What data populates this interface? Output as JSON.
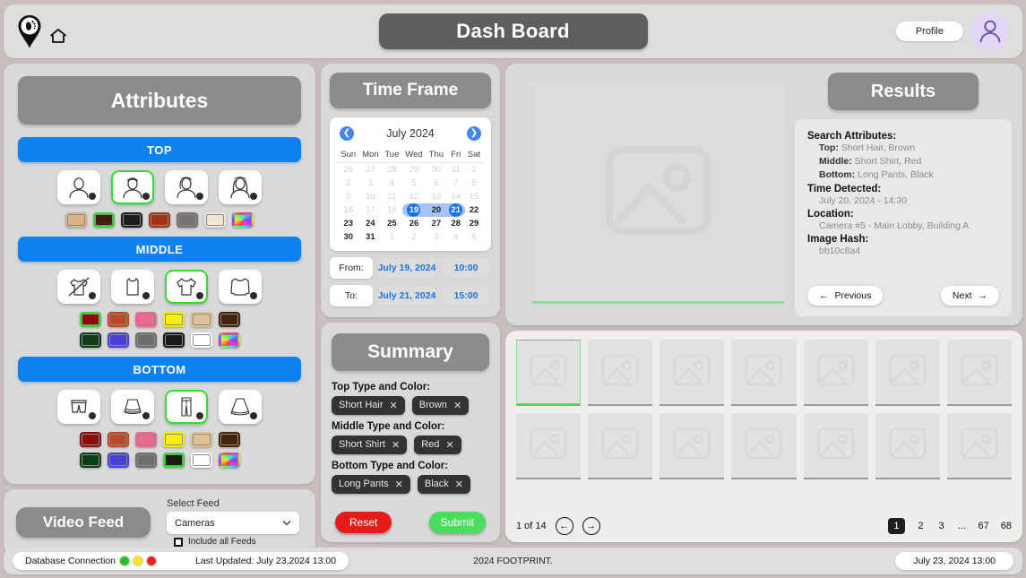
{
  "header": {
    "title": "Dash Board",
    "profile_label": "Profile",
    "logo_icon": "footprint-pin-icon",
    "home_icon": "home-icon",
    "avatar_icon": "user-avatar-icon"
  },
  "attributes": {
    "title": "Attributes",
    "sections": [
      {
        "key": "top",
        "label": "TOP",
        "icons": [
          {
            "name": "hair-long-icon",
            "selected": false
          },
          {
            "name": "hair-short-icon",
            "selected": true
          },
          {
            "name": "hair-medium-icon",
            "selected": false
          },
          {
            "name": "hair-very-long-icon",
            "selected": false
          }
        ],
        "colors": [
          {
            "name": "tan",
            "hex": "#d9b387",
            "selected": false
          },
          {
            "name": "brown",
            "hex": "#3d2008",
            "selected": true
          },
          {
            "name": "black",
            "hex": "#1c1c1c",
            "selected": false
          },
          {
            "name": "rust",
            "hex": "#a33112",
            "selected": false
          },
          {
            "name": "gray",
            "hex": "#77736f",
            "selected": false
          },
          {
            "name": "cream",
            "hex": "#f0e6d8",
            "selected": false
          },
          {
            "name": "multicolor",
            "hex": "rainbow",
            "selected": false
          }
        ]
      },
      {
        "key": "middle",
        "label": "MIDDLE",
        "icons": [
          {
            "name": "no-shirt-icon",
            "selected": false
          },
          {
            "name": "tank-top-icon",
            "selected": false
          },
          {
            "name": "short-shirt-icon",
            "selected": true
          },
          {
            "name": "long-sleeve-icon",
            "selected": false
          }
        ],
        "colors": [
          {
            "name": "red",
            "hex": "#8c0b0b",
            "selected": true
          },
          {
            "name": "orange",
            "hex": "#bd4a26",
            "selected": false
          },
          {
            "name": "pink",
            "hex": "#f2688f",
            "selected": false
          },
          {
            "name": "yellow",
            "hex": "#f5f00a",
            "selected": false
          },
          {
            "name": "tan",
            "hex": "#ddc293",
            "selected": false
          },
          {
            "name": "brown",
            "hex": "#43230a",
            "selected": false
          },
          {
            "name": "green",
            "hex": "#0c3d16",
            "selected": false
          },
          {
            "name": "blue",
            "hex": "#4840d6",
            "selected": false
          },
          {
            "name": "gray",
            "hex": "#6e6e6e",
            "selected": false
          },
          {
            "name": "black",
            "hex": "#1c1915",
            "selected": false
          },
          {
            "name": "white",
            "hex": "#ffffff",
            "selected": false
          },
          {
            "name": "multicolor",
            "hex": "rainbow",
            "selected": false
          }
        ]
      },
      {
        "key": "bottom",
        "label": "BOTTOM",
        "icons": [
          {
            "name": "shorts-icon",
            "selected": false
          },
          {
            "name": "short-skirt-icon",
            "selected": false
          },
          {
            "name": "long-pants-icon",
            "selected": true
          },
          {
            "name": "long-skirt-icon",
            "selected": false
          }
        ],
        "colors": [
          {
            "name": "red",
            "hex": "#8c0b0b",
            "selected": false
          },
          {
            "name": "orange",
            "hex": "#bd4a26",
            "selected": false
          },
          {
            "name": "pink",
            "hex": "#f2688f",
            "selected": false
          },
          {
            "name": "yellow",
            "hex": "#f5f00a",
            "selected": false
          },
          {
            "name": "tan",
            "hex": "#ddc293",
            "selected": false
          },
          {
            "name": "brown",
            "hex": "#43230a",
            "selected": false
          },
          {
            "name": "green",
            "hex": "#0c3d16",
            "selected": false
          },
          {
            "name": "blue",
            "hex": "#4840d6",
            "selected": false
          },
          {
            "name": "gray",
            "hex": "#6e6e6e",
            "selected": false
          },
          {
            "name": "black",
            "hex": "#1c1915",
            "selected": true
          },
          {
            "name": "white",
            "hex": "#ffffff",
            "selected": false
          },
          {
            "name": "multicolor",
            "hex": "rainbow",
            "selected": false
          }
        ]
      }
    ]
  },
  "video_feed": {
    "title": "Video Feed",
    "select_label": "Select Feed",
    "select_value": "Cameras",
    "checkbox_label": "Include all Feeds",
    "checkbox_checked": false,
    "chevron_icon": "chevron-down-icon"
  },
  "time_frame": {
    "title": "Time Frame",
    "ghost_text": "Frame",
    "calendar": {
      "month_label": "July 2024",
      "prev_icon": "chevron-left-icon",
      "next_icon": "chevron-right-icon",
      "weekdays": [
        "Sun",
        "Mon",
        "Tue",
        "Wed",
        "Thu",
        "Fri",
        "Sat"
      ],
      "weeks": [
        [
          {
            "d": "26",
            "muted": true
          },
          {
            "d": "27",
            "muted": true
          },
          {
            "d": "28",
            "muted": true
          },
          {
            "d": "29",
            "muted": true
          },
          {
            "d": "30",
            "muted": true
          },
          {
            "d": "31",
            "muted": true
          },
          {
            "d": "1",
            "muted": true
          }
        ],
        [
          {
            "d": "2",
            "muted": true
          },
          {
            "d": "3",
            "muted": true
          },
          {
            "d": "4",
            "muted": true
          },
          {
            "d": "5",
            "muted": true
          },
          {
            "d": "6",
            "muted": true
          },
          {
            "d": "7",
            "muted": true
          },
          {
            "d": "8",
            "muted": true
          }
        ],
        [
          {
            "d": "9",
            "muted": true
          },
          {
            "d": "10",
            "muted": true
          },
          {
            "d": "11",
            "muted": true
          },
          {
            "d": "12",
            "muted": true
          },
          {
            "d": "13",
            "muted": true
          },
          {
            "d": "14",
            "muted": true
          },
          {
            "d": "15",
            "muted": true
          }
        ],
        [
          {
            "d": "16",
            "muted": true
          },
          {
            "d": "17",
            "muted": true
          },
          {
            "d": "18",
            "muted": true
          },
          {
            "d": "19",
            "muted": false,
            "range": "start"
          },
          {
            "d": "20",
            "muted": false,
            "range": "mid"
          },
          {
            "d": "21",
            "muted": false,
            "range": "end"
          },
          {
            "d": "22",
            "muted": false
          }
        ],
        [
          {
            "d": "23",
            "muted": false
          },
          {
            "d": "24",
            "muted": false
          },
          {
            "d": "25",
            "muted": false
          },
          {
            "d": "26",
            "muted": false
          },
          {
            "d": "27",
            "muted": false
          },
          {
            "d": "28",
            "muted": false
          },
          {
            "d": "29",
            "muted": false
          }
        ],
        [
          {
            "d": "30",
            "muted": false
          },
          {
            "d": "31",
            "muted": false
          },
          {
            "d": "1",
            "muted": true
          },
          {
            "d": "2",
            "muted": true
          },
          {
            "d": "3",
            "muted": true
          },
          {
            "d": "4",
            "muted": true
          },
          {
            "d": "5",
            "muted": true
          }
        ]
      ]
    },
    "from": {
      "label": "From:",
      "date": "July 19, 2024",
      "time": "10:00"
    },
    "to": {
      "label": "To:",
      "date": "July 21, 2024",
      "time": "15:00"
    }
  },
  "summary": {
    "title": "Summary",
    "groups": [
      {
        "label": "Top Type and Color:",
        "chips": [
          "Short Hair",
          "Brown"
        ]
      },
      {
        "label": "Middle Type and Color:",
        "chips": [
          "Short Shirt",
          "Red"
        ]
      },
      {
        "label": "Bottom Type and Color:",
        "chips": [
          "Long Pants",
          "Black"
        ]
      }
    ],
    "chip_remove_icon": "close-icon",
    "reset_label": "Reset",
    "submit_label": "Submit"
  },
  "results": {
    "title": "Results",
    "preview_icon": "image-placeholder-icon",
    "details": {
      "search_attributes_label": "Search Attributes:",
      "top_key": "Top:",
      "top_value": "Short Hair, Brown",
      "middle_key": "Middle:",
      "middle_value": "Short Shirt, Red",
      "bottom_key": "Bottom:",
      "bottom_value": "Long Pants, Black",
      "time_detected_label": "Time Detected:",
      "time_detected_value": "July 20, 2024 - 14:30",
      "location_label": "Location:",
      "location_value": "Camera #5 - Main Lobby, Building A",
      "image_hash_label": "Image Hash:",
      "image_hash_value": "bb10c8a4"
    },
    "prev_label": "Previous",
    "next_label": "Next",
    "prev_icon": "arrow-left-icon",
    "next_icon": "arrow-right-icon"
  },
  "gallery": {
    "thumb_ghost_label": "Image",
    "thumbnails": [
      {
        "id": 1,
        "selected": true
      },
      {
        "id": 2,
        "selected": false
      },
      {
        "id": 3,
        "selected": false
      },
      {
        "id": 4,
        "selected": false
      },
      {
        "id": 5,
        "selected": false
      },
      {
        "id": 6,
        "selected": false
      },
      {
        "id": 7,
        "selected": false
      },
      {
        "id": 8,
        "selected": false
      },
      {
        "id": 9,
        "selected": false
      },
      {
        "id": 10,
        "selected": false
      },
      {
        "id": 11,
        "selected": false
      },
      {
        "id": 12,
        "selected": false
      },
      {
        "id": 13,
        "selected": false
      },
      {
        "id": 14,
        "selected": false
      }
    ],
    "counter": "1 of 14",
    "prev_icon": "circle-arrow-left-icon",
    "next_icon": "circle-arrow-right-icon",
    "pages": [
      {
        "label": "1",
        "active": true
      },
      {
        "label": "2",
        "active": false
      },
      {
        "label": "3",
        "active": false
      },
      {
        "label": "...",
        "active": false
      },
      {
        "label": "67",
        "active": false
      },
      {
        "label": "68",
        "active": false
      }
    ]
  },
  "status_bar": {
    "db_label": "Database Connection",
    "dots": [
      "#22c022",
      "#f5e614",
      "#ec2020"
    ],
    "last_updated": "Last Updated: July 23,2024 13:00",
    "footer_text": "2024 FOOTPRINT.",
    "clock": "July 23, 2024 13:00"
  }
}
